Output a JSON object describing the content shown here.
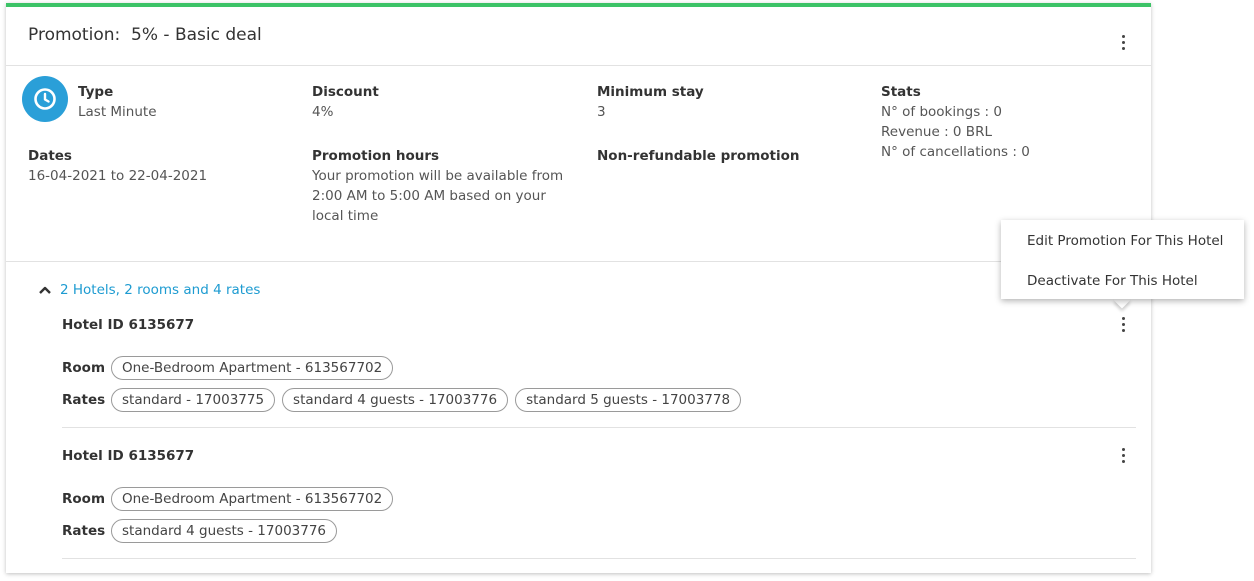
{
  "promotion": {
    "title": "Promotion:  5% - Basic deal",
    "accent_color": "#3cc367"
  },
  "details": {
    "type": {
      "label": "Type",
      "value": "Last Minute",
      "icon": "clock-icon",
      "icon_color": "#2a9fd8"
    },
    "discount": {
      "label": "Discount",
      "value": "4%"
    },
    "minimum_stay": {
      "label": "Minimum stay",
      "value": "3"
    },
    "stats": {
      "label": "Stats",
      "bookings": "N° of bookings : 0",
      "revenue": "Revenue : 0 BRL",
      "cancellations": "N° of cancellations : 0"
    },
    "dates": {
      "label": "Dates",
      "value": "16-04-2021 to 22-04-2021"
    },
    "promotion_hours": {
      "label": "Promotion hours",
      "line1": "Your promotion will be available from",
      "line2": "2:00 AM to 5:00 AM based on your",
      "line3": "local time"
    },
    "non_refundable": {
      "label": "Non-refundable promotion"
    }
  },
  "hotels_section": {
    "toggle_label": "2 Hotels, 2 rooms and 4 rates",
    "room_label": "Room",
    "rates_label": "Rates",
    "hotels": [
      {
        "id_label": "Hotel ID 6135677",
        "room": "One-Bedroom Apartment - 613567702",
        "rates": [
          "standard - 17003775",
          "standard 4 guests - 17003776",
          "standard 5 guests - 17003778"
        ]
      },
      {
        "id_label": "Hotel ID 6135677",
        "room": "One-Bedroom Apartment - 613567702",
        "rates": [
          "standard 4 guests - 17003776"
        ]
      }
    ]
  },
  "context_menu": {
    "edit": "Edit Promotion For This Hotel",
    "deactivate": "Deactivate For This Hotel"
  }
}
